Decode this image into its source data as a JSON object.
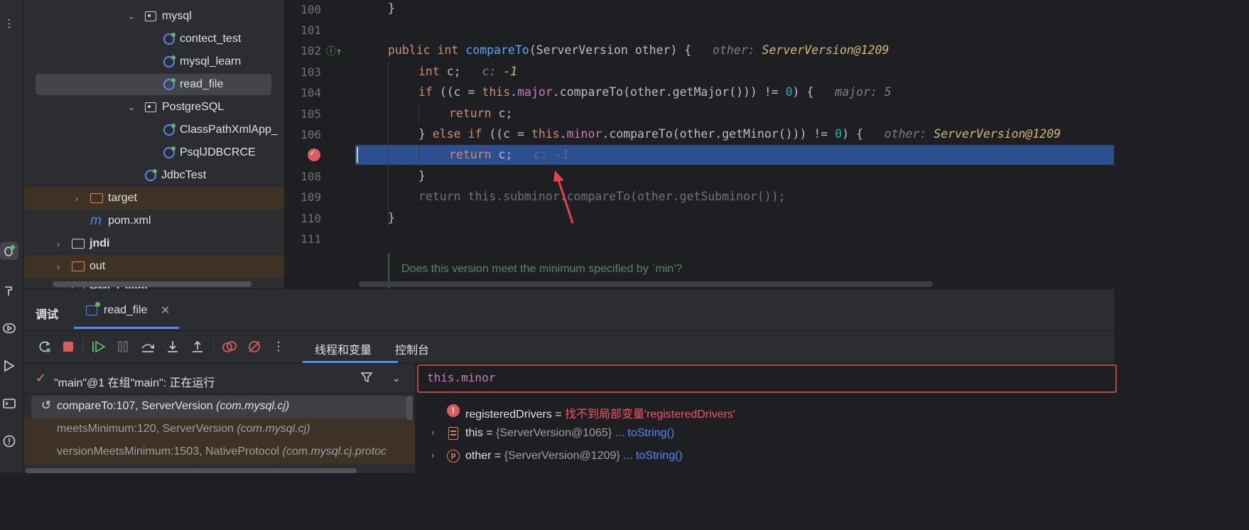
{
  "toolstrip": {
    "icons": [
      "more-icon",
      "debug-icon",
      "build-icon",
      "services-icon",
      "run-icon",
      "terminal-icon",
      "problems-icon"
    ]
  },
  "project_tree": {
    "rows": [
      {
        "label": "mysql",
        "kind": "package",
        "expanded": true
      },
      {
        "label": "contect_test",
        "kind": "class"
      },
      {
        "label": "mysql_learn",
        "kind": "class"
      },
      {
        "label": "read_file",
        "kind": "class",
        "selected": true
      },
      {
        "label": "PostgreSQL",
        "kind": "package",
        "expanded": true
      },
      {
        "label": "ClassPathXmlApp_",
        "kind": "class"
      },
      {
        "label": "PsqlJDBCRCE",
        "kind": "class"
      },
      {
        "label": "JdbcTest",
        "kind": "class"
      },
      {
        "label": "target",
        "kind": "folder-excluded",
        "expanded": false
      },
      {
        "label": "pom.xml",
        "kind": "maven"
      },
      {
        "label": "jndi",
        "kind": "module",
        "expanded": false
      },
      {
        "label": "out",
        "kind": "folder-excluded",
        "expanded": false
      },
      {
        "label": "RMI_Client",
        "kind": "module",
        "expanded": false
      }
    ]
  },
  "editor": {
    "line_numbers": [
      "100",
      "101",
      "102",
      "103",
      "104",
      "105",
      "106",
      "107",
      "108",
      "109",
      "110",
      "111"
    ],
    "lines": {
      "l100": "}",
      "l102_kw1": "public",
      "l102_kw2": "int",
      "l102_fn": "compareTo",
      "l102_rest": "(ServerVersion other) {",
      "l102_hint_name": "other:",
      "l102_hint_val": "ServerVersion@1209",
      "l103_kw": "int",
      "l103_rest": " c;",
      "l103_hint_name": "c:",
      "l103_hint_val": "-1",
      "l104_kw": "if",
      "l104_a": " ((c = ",
      "l104_this": "this",
      "l104_dot": ".",
      "l104_field": "major",
      "l104_b": ".compareTo(other.getMajor())) != ",
      "l104_num": "0",
      "l104_c": ") {",
      "l104_hint_name": "major:",
      "l104_hint_val": "5",
      "l105_kw": "return",
      "l105_rest": " c;",
      "l106_a": "} ",
      "l106_kw1": "else",
      "l106_kw2": "if",
      "l106_b": " ((c = ",
      "l106_this": "this",
      "l106_dot": ".",
      "l106_field": "minor",
      "l106_c": ".compareTo(other.getMinor())) != ",
      "l106_num": "0",
      "l106_d": ") {",
      "l106_hint_name": "other:",
      "l106_hint_val": "ServerVersion@1209",
      "l107_kw": "return",
      "l107_rest": " c;",
      "l107_hint": "c: -1",
      "l108": "}",
      "l109": "return this.subminor.compareTo(other.getSubminor());",
      "l110": "}",
      "doc": "Does this version meet the minimum specified by `min'?"
    }
  },
  "debug": {
    "title": "调试",
    "session_tab": "read_file",
    "subtabs": [
      "线程和变量",
      "控制台"
    ],
    "toolbar": [
      "rerun-icon",
      "stop-icon",
      "resume-icon",
      "pause-icon",
      "step-over-icon",
      "step-into-icon",
      "step-out-icon",
      "view-breakpoints-icon",
      "mute-breakpoints-icon",
      "more-icon"
    ],
    "thread": "\"main\"@1 在组\"main\": 正在运行",
    "frames": [
      {
        "method": "compareTo:107, ServerVersion",
        "pkg": "(com.mysql.cj)"
      },
      {
        "method": "meetsMinimum:120, ServerVersion",
        "pkg": "(com.mysql.cj)"
      },
      {
        "method": "versionMeetsMinimum:1503, NativeProtocol",
        "pkg": "(com.mysql.cj.protoc"
      }
    ],
    "eval_expression": "this.minor",
    "variables": [
      {
        "name": "registeredDrivers",
        "eq": " = ",
        "value": "找不到局部变量'registeredDrivers'",
        "kind": "error"
      },
      {
        "name": "this",
        "eq": " = ",
        "value": "{ServerVersion@1065}",
        "link": "... toString()",
        "kind": "field"
      },
      {
        "name": "other",
        "eq": " = ",
        "value": "{ServerVersion@1209}",
        "link": "... toString()",
        "kind": "param"
      }
    ]
  },
  "colors": {
    "accent": "#548af7",
    "breakpoint": "#db5c5c",
    "current_line": "#2e4f8f"
  }
}
